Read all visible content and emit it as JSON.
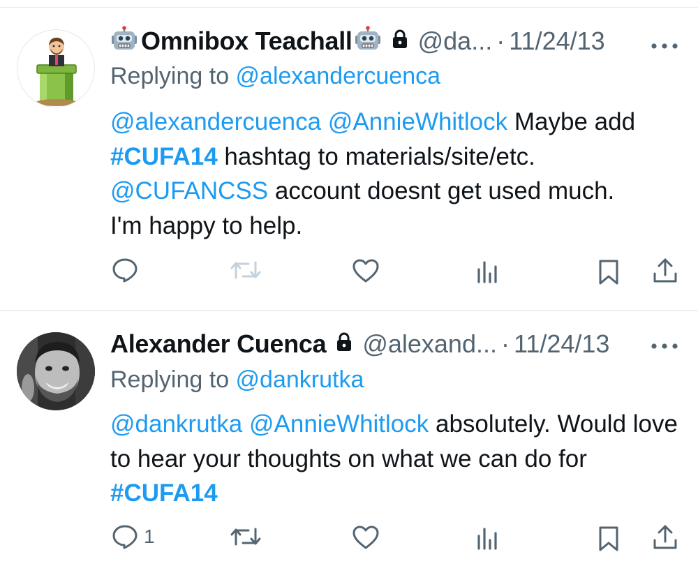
{
  "tweets": [
    {
      "display_name": "Omnibox Teachall",
      "name_emoji": "robot-face-emoji",
      "handle": "@da...",
      "separator": "·",
      "date": "11/24/13",
      "replying_prefix": "Replying to ",
      "replying_to": "@alexandercuenca",
      "body": {
        "mention_1": "@alexandercuenca",
        "mention_2": "@AnnieWhitlock",
        "text_1": " Maybe add",
        "hashtag_1": "#CUFA14",
        "text_2": " hashtag to materials/site/etc.",
        "mention_3": "@CUFANCSS",
        "text_3": " account doesnt get used much.",
        "text_4": "I'm happy to help."
      },
      "actions": {
        "reply_count": "",
        "retweet_count": "",
        "like_count": ""
      }
    },
    {
      "display_name": "Alexander Cuenca",
      "handle": "@alexand...",
      "separator": "·",
      "date": "11/24/13",
      "replying_prefix": "Replying to ",
      "replying_to": "@dankrutka",
      "body": {
        "mention_1": "@dankrutka",
        "mention_2": "@AnnieWhitlock",
        "text_1": " absolutely. Would love to hear your thoughts on what we can do for ",
        "hashtag_1": "#CUFA14"
      },
      "actions": {
        "reply_count": "1",
        "retweet_count": "",
        "like_count": ""
      }
    }
  ],
  "colors": {
    "link": "#1d9bf0",
    "secondary_text": "#536471",
    "primary_text": "#0f1419",
    "icon": "#536471",
    "retweet_disabled": "#c4d1da",
    "divider": "#e6e9eb"
  },
  "icons": {
    "reply": "speech-bubble-icon",
    "retweet": "retweet-icon",
    "like": "heart-icon",
    "views": "bar-chart-icon",
    "bookmark": "bookmark-icon",
    "share": "share-upload-icon",
    "more": "ellipsis-icon",
    "protected": "lock-icon"
  }
}
